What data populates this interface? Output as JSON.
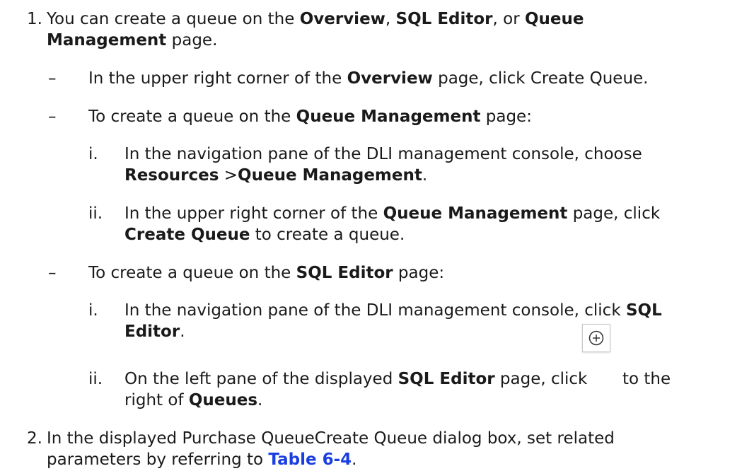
{
  "step1": {
    "number": "1.",
    "t1": "You can create a queue on the ",
    "b1": "Overview",
    "t2": ", ",
    "b2": "SQL Editor",
    "t3": ", or ",
    "b3": "Queue",
    "b4": "Management",
    "t4": " page.",
    "bullet_a": {
      "dash": "–",
      "t1": "In the upper right corner of the ",
      "b1": "Overview",
      "t2": " page, click Create Queue."
    },
    "bullet_b": {
      "dash": "–",
      "t1": "To create a queue on the ",
      "b1": "Queue Management",
      "t2": " page:",
      "sub_i": {
        "num": "i.",
        "t1": "In the navigation pane of the DLI management console, choose",
        "b1": "Resources",
        "t2": " >",
        "b2": "Queue Management",
        "t3": "."
      },
      "sub_ii": {
        "num": "ii.",
        "t1": "In the upper right corner of the ",
        "b1": "Queue Management",
        "t2": " page, click",
        "b2": "Create Queue",
        "t3": " to create a queue."
      }
    },
    "bullet_c": {
      "dash": "–",
      "t1": "To create a queue on the ",
      "b1": "SQL Editor",
      "t2": " page:",
      "sub_i": {
        "num": "i.",
        "t1": "In the navigation pane of the DLI management console, click ",
        "b1": "SQL",
        "b2": "Editor",
        "t2": "."
      },
      "sub_ii": {
        "num": "ii.",
        "t1": "On the left pane of the displayed ",
        "b1": "SQL Editor",
        "t2": " page, click",
        "t3": "to the",
        "t4": "right of ",
        "b2": "Queues",
        "t5": ".",
        "icon": "plus-circle-icon"
      }
    }
  },
  "step2": {
    "number": "2.",
    "t1": "In the displayed Purchase QueueCreate Queue dialog box, set related",
    "t2": "parameters by referring to ",
    "link": "Table 6-4",
    "t3": ".",
    "link_color": "#1a3ee0"
  }
}
